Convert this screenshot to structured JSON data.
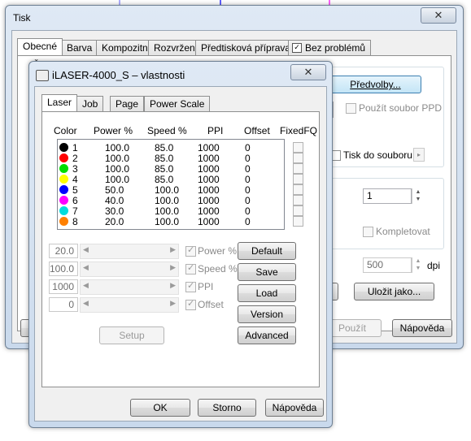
{
  "tisk": {
    "title": "Tisk",
    "close": "✕",
    "tabs": [
      "Obecné",
      "Barva",
      "Kompozitní",
      "Rozvržení",
      "Předtisková příprava",
      "Bez problémů"
    ],
    "partial_label": "Č",
    "preferences_button": "Předvolby...",
    "use_ppd_label": "Použít soubor PPD",
    "print_to_file_label": "Tisk do souboru",
    "copies_value": "1",
    "collate_label": "Kompletovat",
    "resolution_value": "500",
    "resolution_unit": "dpi",
    "resolution_colon": ":",
    "save_as_button": "Uložit jako...",
    "print_button": "Použít",
    "help_button": "Nápověda"
  },
  "props": {
    "title": "iLASER-4000_S – vlastnosti",
    "close": "✕",
    "tabs": [
      "Laser",
      "Job",
      "Page",
      "Power Scale"
    ],
    "columns": [
      "Color",
      "Power %",
      "Speed %",
      "PPI",
      "Offset",
      "FixedFQ"
    ],
    "rows": [
      {
        "n": "1",
        "color": "#000000",
        "power": "100.0",
        "speed": "85.0",
        "ppi": "1000",
        "offset": "0"
      },
      {
        "n": "2",
        "color": "#ff0000",
        "power": "100.0",
        "speed": "85.0",
        "ppi": "1000",
        "offset": "0"
      },
      {
        "n": "3",
        "color": "#00dd00",
        "power": "100.0",
        "speed": "85.0",
        "ppi": "1000",
        "offset": "0"
      },
      {
        "n": "4",
        "color": "#ffff00",
        "power": "100.0",
        "speed": "85.0",
        "ppi": "1000",
        "offset": "0"
      },
      {
        "n": "5",
        "color": "#0000ff",
        "power": "50.0",
        "speed": "100.0",
        "ppi": "1000",
        "offset": "0"
      },
      {
        "n": "6",
        "color": "#ff00ff",
        "power": "40.0",
        "speed": "100.0",
        "ppi": "1000",
        "offset": "0"
      },
      {
        "n": "7",
        "color": "#00dddd",
        "power": "30.0",
        "speed": "100.0",
        "ppi": "1000",
        "offset": "0"
      },
      {
        "n": "8",
        "color": "#ff8000",
        "power": "20.0",
        "speed": "100.0",
        "ppi": "1000",
        "offset": "0"
      }
    ],
    "controls": [
      {
        "value": "20.0",
        "label": "Power %"
      },
      {
        "value": "100.0",
        "label": "Speed %"
      },
      {
        "value": "1000",
        "label": "PPI"
      },
      {
        "value": "0",
        "label": "Offset"
      }
    ],
    "buttons": {
      "default": "Default",
      "save": "Save",
      "load": "Load",
      "version": "Version",
      "advanced": "Advanced",
      "setup": "Setup",
      "ok": "OK",
      "cancel": "Storno",
      "help": "Nápověda"
    }
  }
}
